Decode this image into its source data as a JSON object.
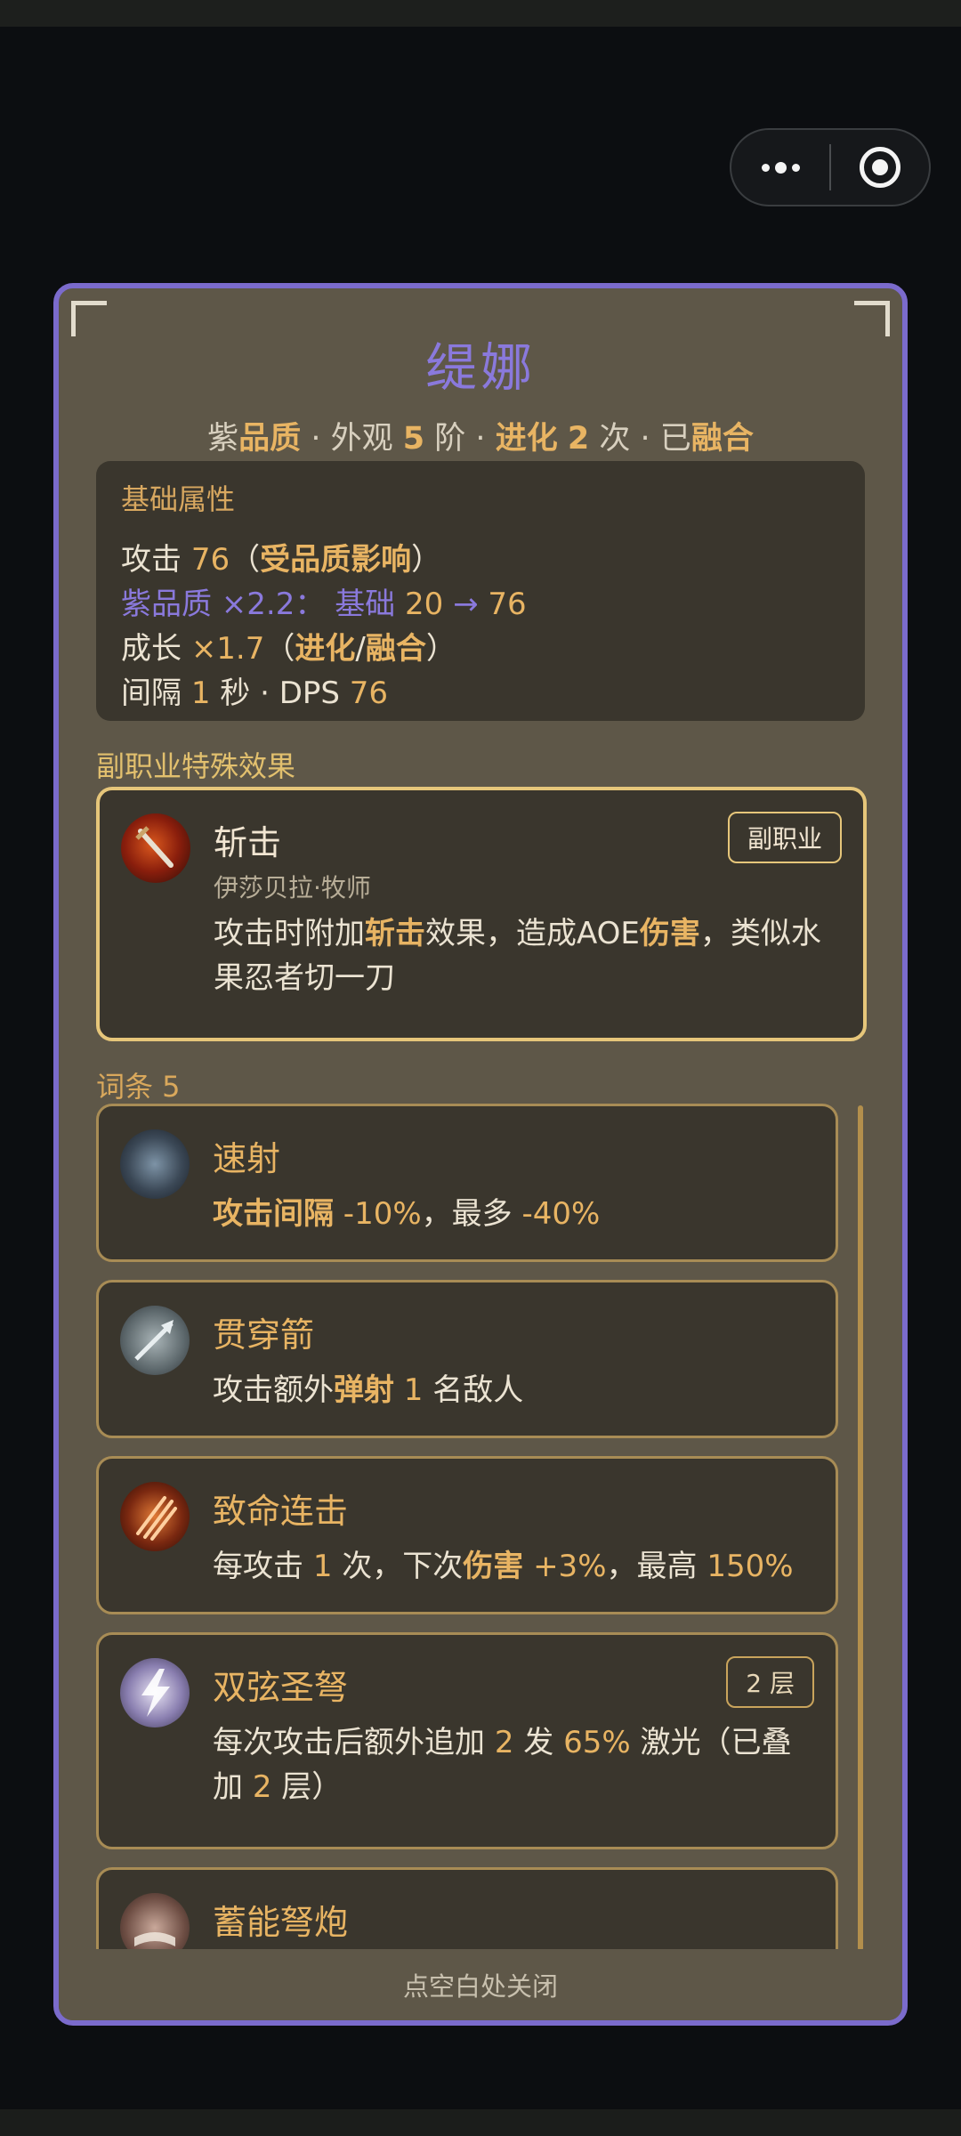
{
  "capsule": {
    "more_icon": "more-dots-icon",
    "close_icon": "target-circle-icon"
  },
  "hero": {
    "name": "缇娜",
    "subtitle": {
      "quality_prefix": "紫",
      "quality_word": "品质",
      "sep1": "·",
      "appearance_label": "外观",
      "appearance_value": "5",
      "appearance_unit": "阶",
      "sep2": "·",
      "evolve_word": "进化",
      "evolve_value": "2",
      "evolve_unit": "次",
      "sep3": "·",
      "fused_prefix": "已",
      "fused_word": "融合"
    }
  },
  "base_attrs": {
    "section_title": "基础属性",
    "attack_label": "攻击",
    "attack_value": "76",
    "attack_note_open": "（",
    "attack_note": "受品质影响",
    "attack_note_close": "）",
    "quality_label": "紫品质 ×2.2",
    "quality_colon": "：",
    "base_label": "基础",
    "base_from": "20",
    "arrow": "→",
    "base_to": "76",
    "growth_label": "成长",
    "growth_value": "×1.7",
    "growth_open": "（",
    "growth_evolve": "进化",
    "growth_slash": "/",
    "growth_fuse": "融合",
    "growth_close": "）",
    "interval_label": "间隔",
    "interval_value": "1",
    "interval_unit": "秒",
    "interval_sep": "·",
    "dps_label": "DPS",
    "dps_value": "76"
  },
  "special": {
    "section_title": "副职业特殊效果",
    "icon": "slash-skill-icon",
    "name": "斩击",
    "source": "伊莎贝拉·牧师",
    "badge": "副职业",
    "desc_1": "攻击时附加",
    "desc_kw1": "斩击",
    "desc_2": "效果，造成AOE",
    "desc_kw2": "伤害",
    "desc_3": "，类似水果忍者切一刀"
  },
  "traits": {
    "section_title": "词条 5",
    "items": [
      {
        "icon": "boot-icon",
        "name": "速射",
        "parts": [
          {
            "t": "攻击间隔",
            "c": "kw"
          },
          {
            "t": " -10%",
            "c": "num"
          },
          {
            "t": "，最多 ",
            "c": ""
          },
          {
            "t": "-40%",
            "c": "num"
          }
        ]
      },
      {
        "icon": "piercing-arrow-icon",
        "name": "贯穿箭",
        "parts": [
          {
            "t": "攻击额外",
            "c": ""
          },
          {
            "t": "弹射",
            "c": "kw"
          },
          {
            "t": " 1 ",
            "c": "num"
          },
          {
            "t": "名敌人",
            "c": ""
          }
        ]
      },
      {
        "icon": "critical-claw-icon",
        "name": "致命连击",
        "parts": [
          {
            "t": "每攻击 ",
            "c": ""
          },
          {
            "t": "1",
            "c": "num"
          },
          {
            "t": " 次，下次",
            "c": ""
          },
          {
            "t": "伤害",
            "c": "kw"
          },
          {
            "t": " +3%",
            "c": "num"
          },
          {
            "t": "，最高 ",
            "c": ""
          },
          {
            "t": "150%",
            "c": "num"
          }
        ]
      },
      {
        "icon": "lightning-crossbow-icon",
        "name": "双弦圣弩",
        "badge": "2 层",
        "parts": [
          {
            "t": "每次攻击后额外追加 ",
            "c": ""
          },
          {
            "t": "2",
            "c": "num"
          },
          {
            "t": " 发 ",
            "c": ""
          },
          {
            "t": "65%",
            "c": "num"
          },
          {
            "t": " 激光（已叠加 ",
            "c": ""
          },
          {
            "t": "2",
            "c": "num"
          },
          {
            "t": " 层）",
            "c": ""
          }
        ]
      },
      {
        "icon": "spellbook-icon",
        "name": "蓄能弩炮",
        "parts": []
      }
    ]
  },
  "footer": {
    "close_hint": "点空白处关闭"
  }
}
